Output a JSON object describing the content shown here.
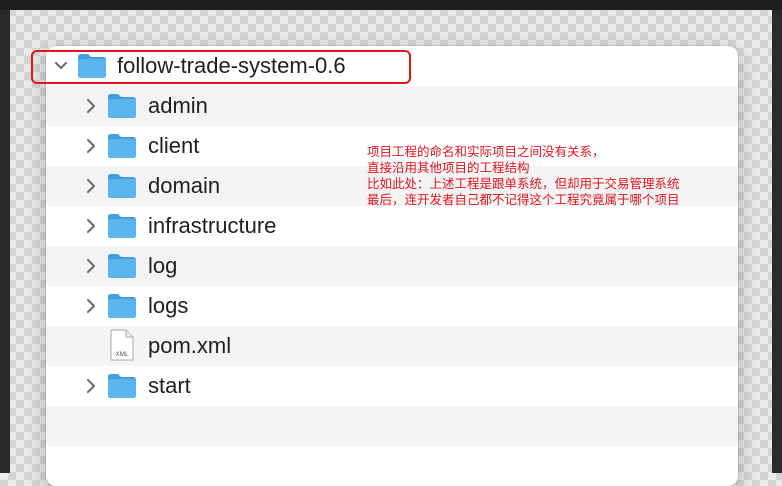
{
  "window": {
    "root": {
      "name": "follow-trade-system-0.6",
      "expanded": true
    },
    "items": [
      {
        "name": "admin",
        "kind": "folder"
      },
      {
        "name": "client",
        "kind": "folder"
      },
      {
        "name": "domain",
        "kind": "folder"
      },
      {
        "name": "infrastructure",
        "kind": "folder"
      },
      {
        "name": "log",
        "kind": "folder"
      },
      {
        "name": "logs",
        "kind": "folder"
      },
      {
        "name": "pom.xml",
        "kind": "file",
        "file_badge": "XML"
      },
      {
        "name": "start",
        "kind": "folder"
      }
    ]
  },
  "annotation": {
    "lines": [
      "项目工程的命名和实际项目之间没有关系，",
      "直接沿用其他项目的工程结构",
      "比如此处：上述工程是跟单系统，但却用于交易管理系统",
      "最后，连开发者自己都不记得这个工程究竟属于哪个项目"
    ],
    "color": "#e0161e"
  },
  "colors": {
    "folder_blue": "#5ab4ee",
    "highlight": "#e0161e"
  },
  "icons": {
    "expanded": "chevron-down-icon",
    "collapsed": "chevron-right-icon",
    "folder": "folder-icon",
    "file": "xml-file-icon"
  }
}
